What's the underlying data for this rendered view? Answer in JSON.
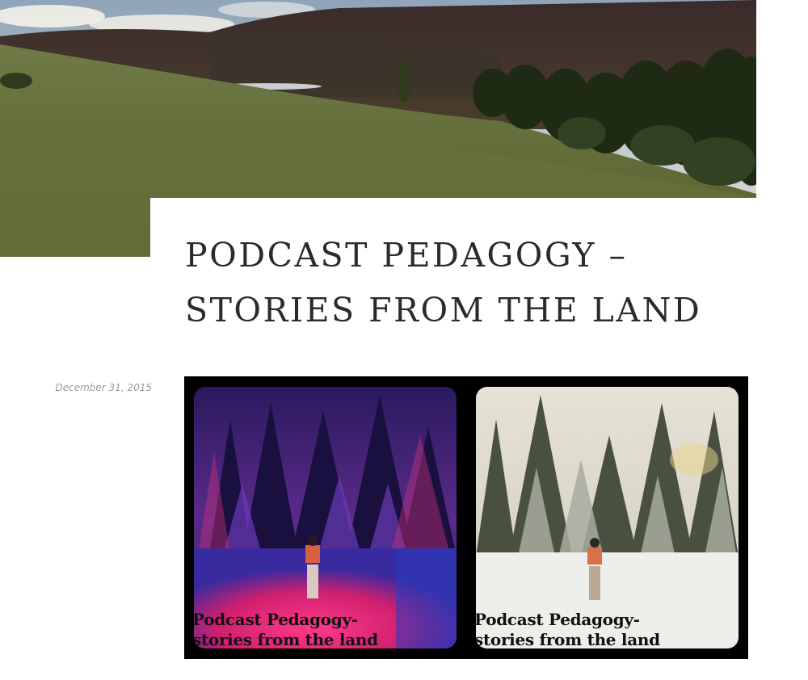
{
  "post": {
    "title": "PODCAST PEDAGOGY – STORIES FROM THE LAND",
    "date": "December 31, 2015"
  },
  "featured_image": {
    "caption_line1": "Podcast Pedagogy-",
    "caption_line2": "stories from the land"
  },
  "colors": {
    "title_text": "#2b2b2b",
    "date_text": "#9a9a9a",
    "image_frame": "#000000"
  }
}
